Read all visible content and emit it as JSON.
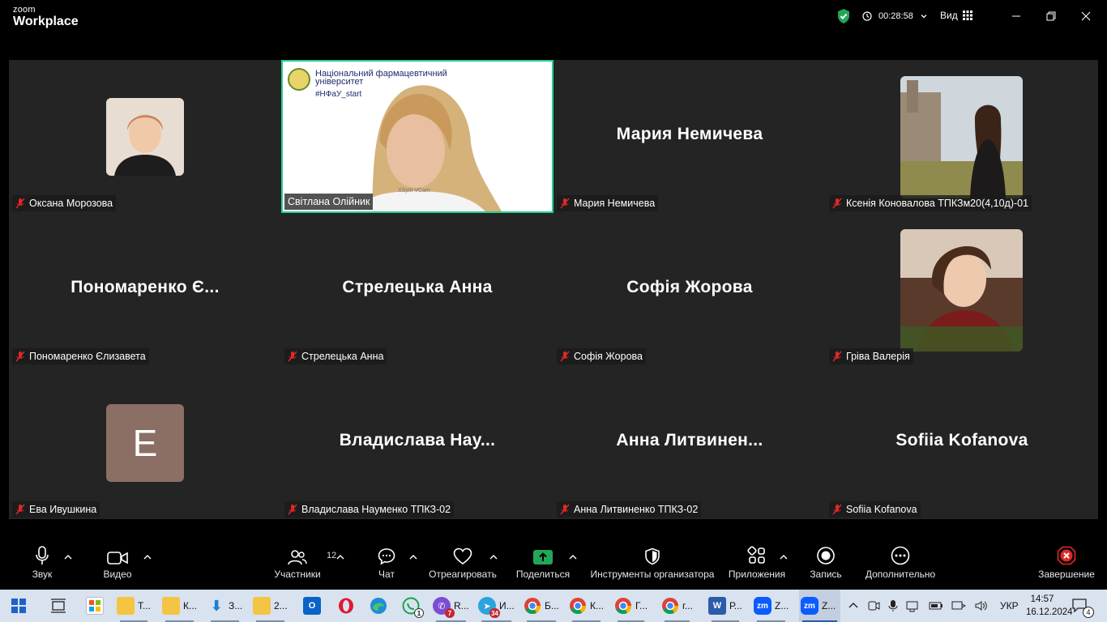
{
  "app": {
    "brand_small": "zoom",
    "brand_big": "Workplace",
    "timer": "00:28:58",
    "view_label": "Вид"
  },
  "tiles": [
    {
      "label": "Оксана Морозова"
    },
    {
      "label": "Світлана Олійник",
      "banner_line1": "Національний фармацевтичний",
      "banner_line2": "університет",
      "banner_tag": "#НФаУ_start",
      "watermark": "XSplit VCam"
    },
    {
      "display_name": "Мария Немичева",
      "label": "Мария Немичева"
    },
    {
      "label": "Ксенія Коновалова ТПКЗм20(4,10д)-01"
    },
    {
      "display_name": "Пономаренко Є...",
      "label": "Пономаренко Єлизавета"
    },
    {
      "display_name": "Стрелецька Анна",
      "label": "Стрелецька Анна"
    },
    {
      "display_name": "Софія Жорова",
      "label": "Софія Жорова"
    },
    {
      "label": "Гріва Валерія"
    },
    {
      "avatar_letter": "E",
      "label": "Ева Ивушкина"
    },
    {
      "display_name": "Владислава  Нау...",
      "label": "Владислава Науменко ТПКЗ-02"
    },
    {
      "display_name": "Анна  Литвинен...",
      "label": "Анна Литвиненко ТПКЗ-02"
    },
    {
      "display_name": "Sofiia Kofanova",
      "label": "Sofiia Kofanova"
    }
  ],
  "toolbar": {
    "audio": "Звук",
    "video": "Видео",
    "participants": "Участники",
    "participants_count": "12",
    "chat": "Чат",
    "react": "Отреагировать",
    "share": "Поделиться",
    "host_tools": "Инструменты организатора",
    "apps": "Приложения",
    "record": "Запись",
    "more": "Дополнительно",
    "end": "Завершение"
  },
  "taskbar": {
    "items": [
      "Т...",
      "К...",
      "З...",
      "2...",
      "R...",
      "И...",
      "Б...",
      "К...",
      "Г...",
      "г...",
      "Р...",
      "Z...",
      "Z..."
    ],
    "whatsapp_badge": "1",
    "viber_badge": "7",
    "telegram_badge": "34",
    "lang": "УКР",
    "time": "14:57",
    "date": "16.12.2024",
    "notif_count": "4"
  }
}
